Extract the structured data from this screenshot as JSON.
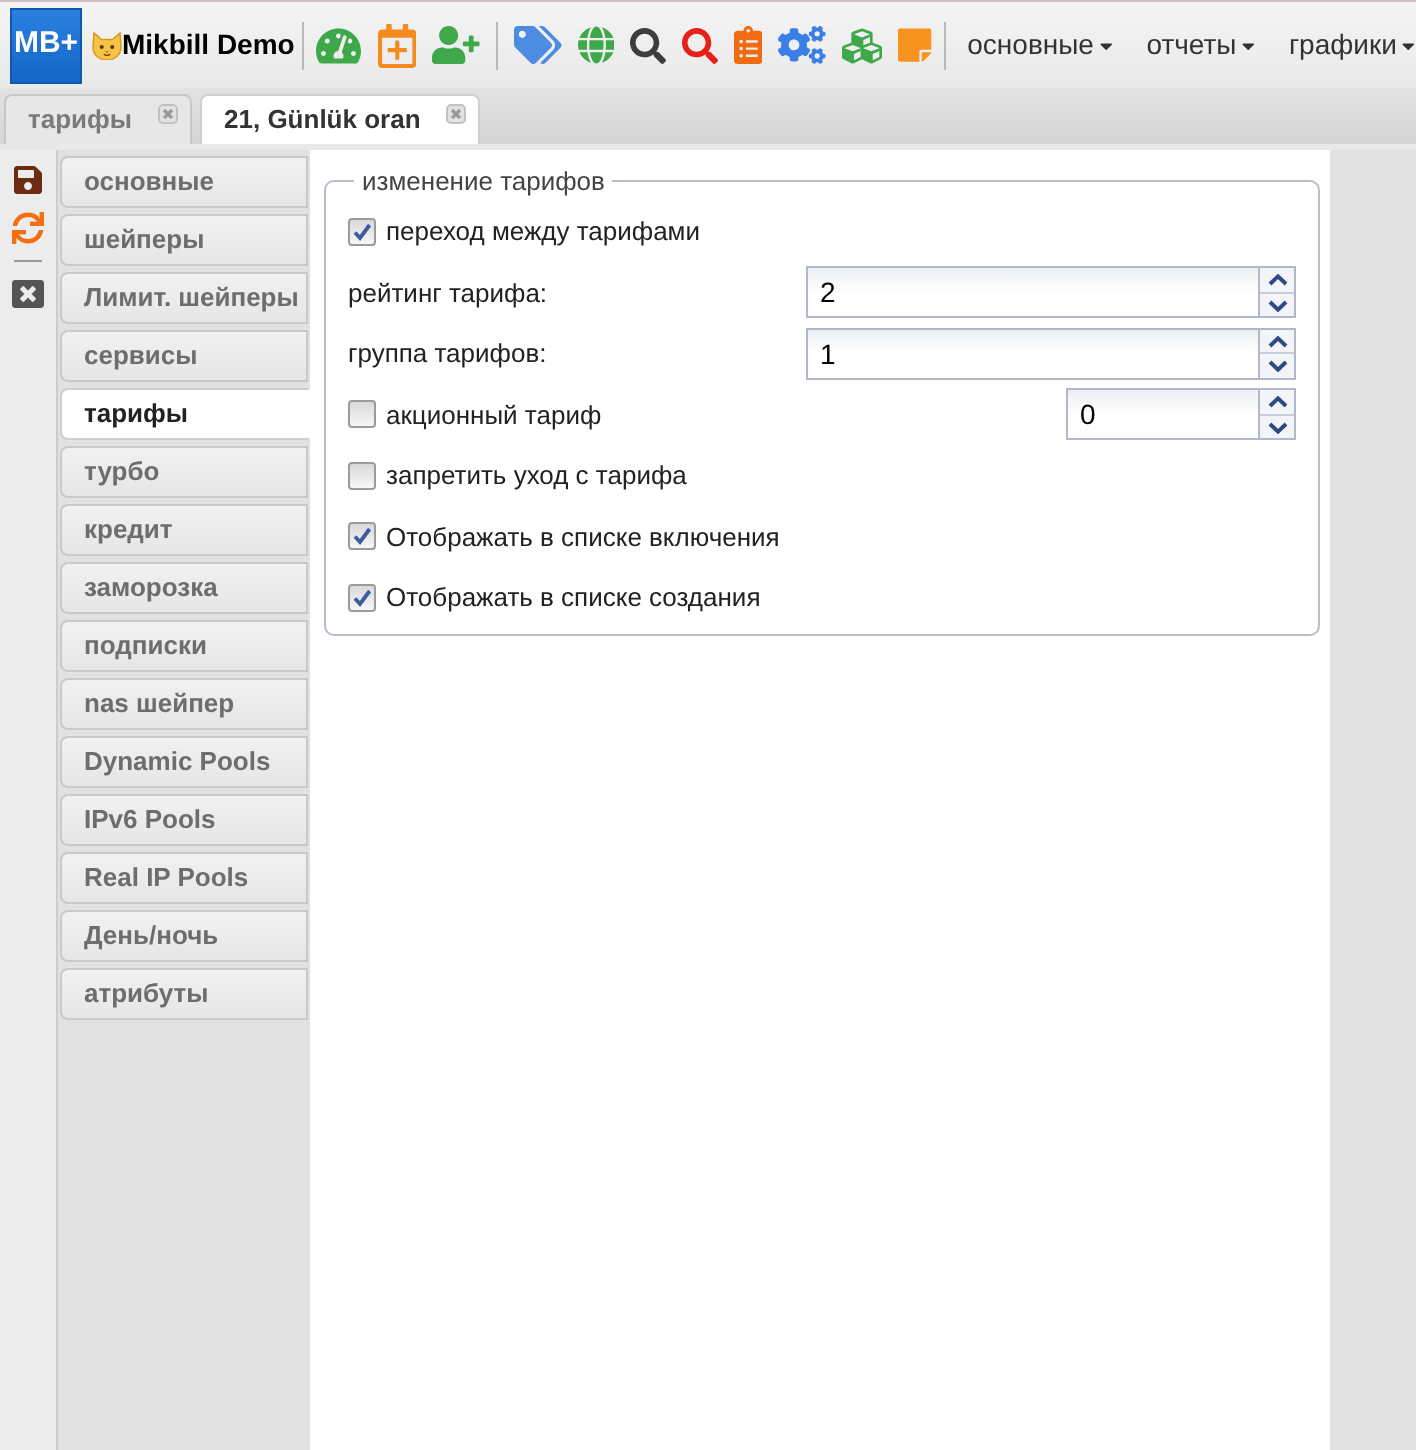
{
  "header": {
    "logo": "MB+",
    "title": "Mikbill Demo",
    "menus": [
      {
        "label": "основные"
      },
      {
        "label": "отчеты"
      },
      {
        "label": "графики"
      }
    ]
  },
  "tabs": [
    {
      "label": "тарифы",
      "selected": false
    },
    {
      "label": "21, Günlük oran",
      "selected": true
    }
  ],
  "sidebar": {
    "items": [
      {
        "label": "основные",
        "selected": false
      },
      {
        "label": "шейперы",
        "selected": false
      },
      {
        "label": "Лимит. шейперы",
        "selected": false
      },
      {
        "label": "сервисы",
        "selected": false
      },
      {
        "label": "тарифы",
        "selected": true
      },
      {
        "label": "турбо",
        "selected": false
      },
      {
        "label": "кредит",
        "selected": false
      },
      {
        "label": "заморозка",
        "selected": false
      },
      {
        "label": "подписки",
        "selected": false
      },
      {
        "label": "nas шейпер",
        "selected": false
      },
      {
        "label": "Dynamic Pools",
        "selected": false
      },
      {
        "label": "IPv6 Pools",
        "selected": false
      },
      {
        "label": "Real IP Pools",
        "selected": false
      },
      {
        "label": "День/ночь",
        "selected": false
      },
      {
        "label": "атрибуты",
        "selected": false
      }
    ]
  },
  "form": {
    "legend": "изменение тарифов",
    "rows": [
      {
        "kind": "checkbox",
        "label": "переход между тарифами",
        "checked": true
      },
      {
        "kind": "number",
        "label": "рейтинг тарифа:",
        "value": "2"
      },
      {
        "kind": "number",
        "label": "группа тарифов:",
        "value": "1"
      },
      {
        "kind": "checkbox_number",
        "label": "акционный тариф",
        "checked": false,
        "value": "0"
      },
      {
        "kind": "checkbox",
        "label": "запретить уход с тарифа",
        "checked": false
      },
      {
        "kind": "checkbox",
        "label": "Отображать в списке включения",
        "checked": true
      },
      {
        "kind": "checkbox",
        "label": "Отображать в списке создания",
        "checked": true
      }
    ]
  }
}
